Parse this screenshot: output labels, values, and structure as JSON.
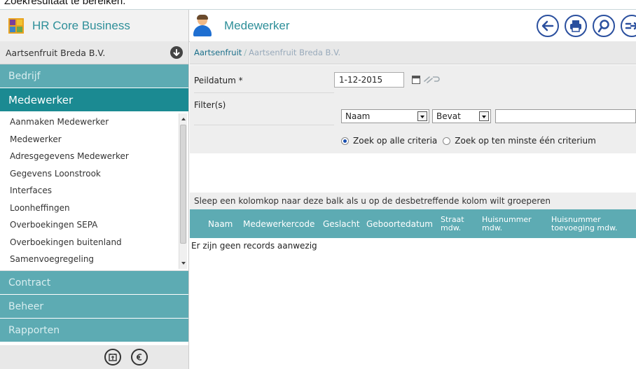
{
  "caption": "Zoekresultaat te bereiken.",
  "header": {
    "app_title": "HR Core Business",
    "page_title": "Medewerker",
    "tools": [
      "back-arrow-icon",
      "printer-icon",
      "search-icon",
      "exit-icon"
    ]
  },
  "sidebar": {
    "company": "Aartsenfruit Breda B.V.",
    "sections": [
      {
        "label": "Bedrijf"
      },
      {
        "label": "Medewerker"
      },
      {
        "label": "Contract"
      },
      {
        "label": "Beheer"
      },
      {
        "label": "Rapporten"
      }
    ],
    "items": [
      {
        "label": "Aanmaken Medewerker"
      },
      {
        "label": "Medewerker"
      },
      {
        "label": "Adresgegevens Medewerker"
      },
      {
        "label": "Gegevens Loonstrook"
      },
      {
        "label": "Interfaces"
      },
      {
        "label": "Loonheffingen"
      },
      {
        "label": "Overboekingen SEPA"
      },
      {
        "label": "Overboekingen buitenland"
      },
      {
        "label": "Samenvoegregeling"
      }
    ]
  },
  "breadcrumb": {
    "link": "Aartsenfruit",
    "separator": "/",
    "current": "Aartsenfruit Breda B.V."
  },
  "filters": {
    "peildatum_label": "Peildatum *",
    "peildatum_value": "1-12-2015",
    "filter_label": "Filter(s)",
    "field_select": "Naam",
    "operator_select": "Bevat",
    "value_input": "",
    "radio_all": "Zoek op alle criteria",
    "radio_one": "Zoek op ten minste één criterium",
    "radio_selected": "all"
  },
  "grid": {
    "group_hint": "Sleep een kolomkop naar deze balk als u op de desbetreffende kolom wilt groeperen",
    "columns": [
      {
        "label": "Naam"
      },
      {
        "label": "Medewerkercode"
      },
      {
        "label": "Geslacht"
      },
      {
        "label": "Geboortedatum"
      },
      {
        "label": "Straat\nmdw."
      },
      {
        "label": "Huisnummer\nmdw."
      },
      {
        "label": "Huisnummer\ntoevoeging mdw."
      }
    ],
    "empty_text": "Er zijn geen records aanwezig"
  },
  "colors": {
    "accent": "#1b8a92",
    "accent_light": "#5dabb3",
    "title": "#2e8f99",
    "icon_blue": "#2a4f9e"
  }
}
